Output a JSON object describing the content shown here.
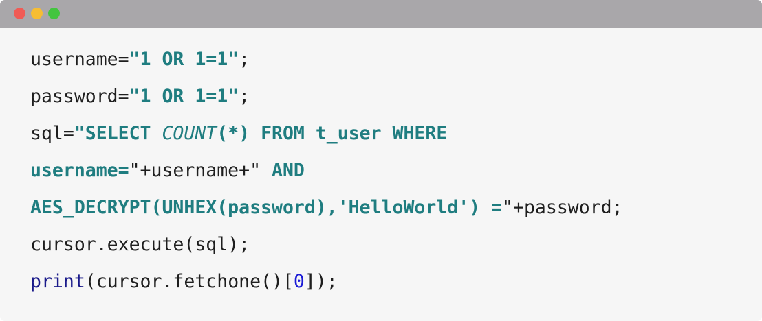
{
  "window": {
    "title_bar_controls": [
      {
        "name": "close",
        "color": "#f05b55"
      },
      {
        "name": "minimize",
        "color": "#f6bd33"
      },
      {
        "name": "maximize",
        "color": "#43c53f"
      }
    ]
  },
  "colors": {
    "plain_text": "#1e1e1e",
    "string": "#1f7d80",
    "keyword": "#1a1a8a",
    "number": "#1b1bd6",
    "background": "#f6f6f6",
    "titlebar": "#a9a7aa"
  },
  "code": {
    "lines": [
      [
        {
          "text": "username=",
          "kind": "plain"
        },
        {
          "text": "\"1 OR 1=1\"",
          "kind": "string"
        },
        {
          "text": ";",
          "kind": "plain"
        }
      ],
      [
        {
          "text": "password=",
          "kind": "plain"
        },
        {
          "text": "\"1 OR 1=1\"",
          "kind": "string"
        },
        {
          "text": ";",
          "kind": "plain"
        }
      ],
      [
        {
          "text": "sql=",
          "kind": "plain"
        },
        {
          "text": "\"SELECT ",
          "kind": "string"
        },
        {
          "text": "COUNT",
          "kind": "string-italic"
        },
        {
          "text": "(*) FROM t_user WHERE",
          "kind": "string"
        }
      ],
      [
        {
          "text": "username=",
          "kind": "string"
        },
        {
          "text": "\"+username+\"",
          "kind": "plain"
        },
        {
          "text": " AND",
          "kind": "string"
        }
      ],
      [
        {
          "text": "AES_DECRYPT(UNHEX(password),'HelloWorld') =",
          "kind": "string"
        },
        {
          "text": "\"+password;",
          "kind": "plain"
        }
      ],
      [
        {
          "text": "cursor.execute(sql);",
          "kind": "plain"
        }
      ],
      [
        {
          "text": "print",
          "kind": "keyword"
        },
        {
          "text": "(cursor.fetchone()[",
          "kind": "plain"
        },
        {
          "text": "0",
          "kind": "number"
        },
        {
          "text": "]);",
          "kind": "plain"
        }
      ]
    ]
  }
}
